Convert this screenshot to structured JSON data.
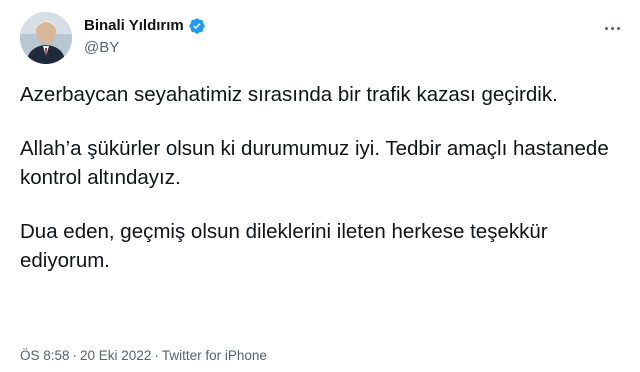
{
  "author": {
    "display_name": "Binali Yıldırım",
    "handle": "@BY",
    "verified": true,
    "verified_color": "#1d9bf0"
  },
  "tweet": {
    "paragraphs": [
      "Azerbaycan seyahatimiz sırasında bir trafik kazası geçirdik.",
      "Allah’a şükürler olsun ki durumumuz iyi. Tedbir amaçlı hastanede kontrol altındayız.",
      "Dua eden, geçmiş olsun dileklerini ileten herkese teşekkür ediyorum."
    ],
    "time": "ÖS 8:58",
    "separator": "·",
    "date": "20 Eki 2022",
    "source": "Twitter for iPhone"
  },
  "icons": {
    "verified": "verified-badge-icon",
    "more": "more-options-icon"
  },
  "colors": {
    "text_primary": "#0f1419",
    "text_secondary": "#536471",
    "background": "#ffffff"
  }
}
